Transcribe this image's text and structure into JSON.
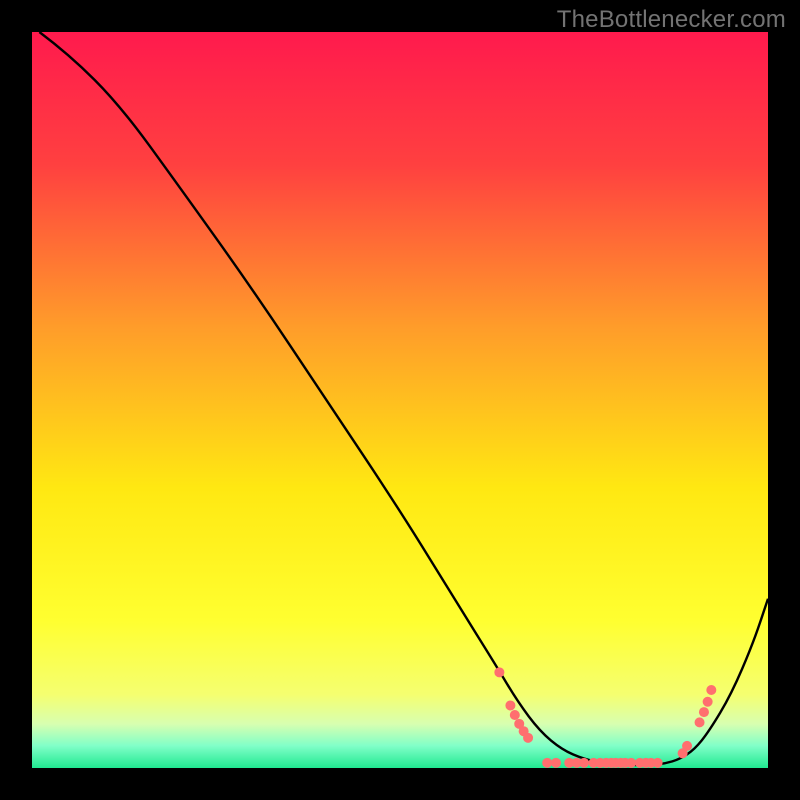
{
  "attribution": "TheBottlenecker.com",
  "chart_data": {
    "type": "line",
    "title": "",
    "xlabel": "",
    "ylabel": "",
    "xlim": [
      0,
      100
    ],
    "ylim": [
      0,
      100
    ],
    "grid": false,
    "legend": false,
    "background_gradient": {
      "stops": [
        {
          "pos": 0.0,
          "color": "#ff1a4d"
        },
        {
          "pos": 0.18,
          "color": "#ff4040"
        },
        {
          "pos": 0.4,
          "color": "#ff9c2a"
        },
        {
          "pos": 0.62,
          "color": "#ffe812"
        },
        {
          "pos": 0.8,
          "color": "#ffff30"
        },
        {
          "pos": 0.9,
          "color": "#f5ff70"
        },
        {
          "pos": 0.94,
          "color": "#d8ffb0"
        },
        {
          "pos": 0.97,
          "color": "#80ffc8"
        },
        {
          "pos": 1.0,
          "color": "#20e890"
        }
      ]
    },
    "series": [
      {
        "name": "curve",
        "stroke": "#000000",
        "x": [
          1,
          5,
          12,
          20,
          30,
          40,
          50,
          58,
          63,
          66,
          69,
          72,
          75,
          78,
          81,
          84,
          86,
          88,
          90,
          92,
          95,
          98,
          100
        ],
        "y": [
          100,
          97,
          90,
          79,
          65,
          50,
          35,
          22,
          14,
          9,
          5,
          2.5,
          1.2,
          0.6,
          0.4,
          0.4,
          0.6,
          1.2,
          2.5,
          5,
          10,
          17,
          23
        ]
      }
    ],
    "points": {
      "name": "markers",
      "color": "#ff6f6f",
      "radius": 5,
      "items": [
        {
          "x": 63.5,
          "y": 13
        },
        {
          "x": 65.0,
          "y": 8.5
        },
        {
          "x": 65.6,
          "y": 7.2
        },
        {
          "x": 66.2,
          "y": 6.0
        },
        {
          "x": 66.8,
          "y": 5.0
        },
        {
          "x": 67.4,
          "y": 4.1
        },
        {
          "x": 70.0,
          "y": 0.7
        },
        {
          "x": 71.2,
          "y": 0.7
        },
        {
          "x": 73.0,
          "y": 0.7
        },
        {
          "x": 74.0,
          "y": 0.7
        },
        {
          "x": 75.0,
          "y": 0.7
        },
        {
          "x": 76.3,
          "y": 0.7
        },
        {
          "x": 77.2,
          "y": 0.7
        },
        {
          "x": 78.0,
          "y": 0.7
        },
        {
          "x": 78.7,
          "y": 0.7
        },
        {
          "x": 79.3,
          "y": 0.7
        },
        {
          "x": 80.0,
          "y": 0.7
        },
        {
          "x": 80.6,
          "y": 0.7
        },
        {
          "x": 81.4,
          "y": 0.7
        },
        {
          "x": 82.6,
          "y": 0.7
        },
        {
          "x": 83.4,
          "y": 0.7
        },
        {
          "x": 84.1,
          "y": 0.7
        },
        {
          "x": 85.0,
          "y": 0.7
        },
        {
          "x": 88.4,
          "y": 2.0
        },
        {
          "x": 89.0,
          "y": 3.0
        },
        {
          "x": 90.7,
          "y": 6.2
        },
        {
          "x": 91.3,
          "y": 7.6
        },
        {
          "x": 91.8,
          "y": 9.0
        },
        {
          "x": 92.3,
          "y": 10.6
        }
      ]
    }
  }
}
